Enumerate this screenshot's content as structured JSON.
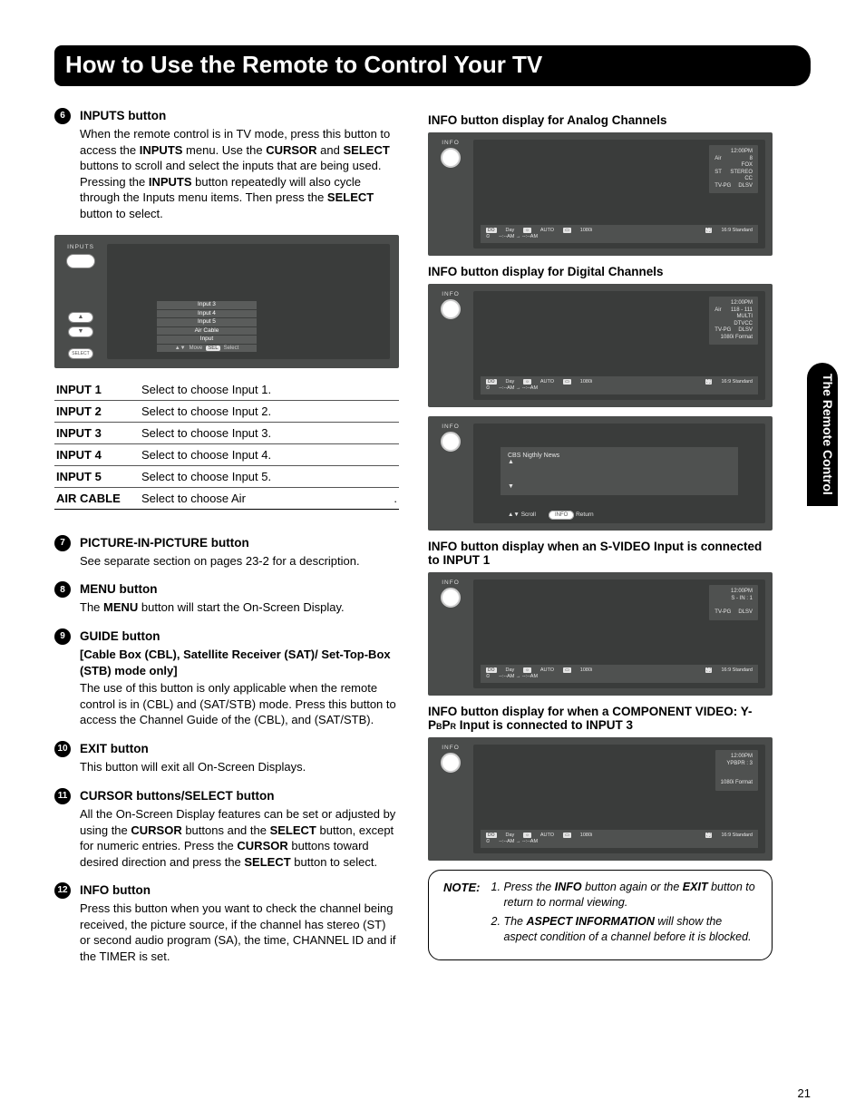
{
  "page": {
    "title": "How to Use the Remote to Control Your TV",
    "side_tab": "The Remote Control",
    "page_number": "21"
  },
  "left_entries": [
    {
      "num": "6",
      "title": "INPUTS button",
      "html": "When the remote control is in TV mode, press this button to access the <b>INPUTS</b> menu. Use the <b>CURSOR</b> and <b>SELECT</b> buttons to scroll and select the inputs that are being used. Pressing the <b>INPUTS</b> button repeatedly will also cycle through the Inputs menu items. Then press the <b>SELECT</b> button to select."
    },
    {
      "num": "7",
      "title": "PICTURE-IN-PICTURE button",
      "html": "See separate section on pages 23-2  for a description."
    },
    {
      "num": "8",
      "title": "MENU button",
      "html": "The <b>MENU</b> button will start the On-Screen Display."
    },
    {
      "num": "9",
      "title": "GUIDE button",
      "sub_html": "[Cable Box (CBL), Satellite Receiver (SAT)/ Set-Top-Box (STB) mode only]",
      "html": "The use of this button is only applicable when the remote control is in (CBL) and (SAT/STB) mode. Press this button to access the Channel Guide of the (CBL), and (SAT/STB)."
    },
    {
      "num": "10",
      "title": "EXIT button",
      "html": "This button will exit all On-Screen Displays."
    },
    {
      "num": "11",
      "title": "CURSOR buttons/SELECT button",
      "html": "All the On-Screen Display features can be set or adjusted by using the <b>CURSOR</b> buttons and the <b>SELECT</b> button, except for numeric entries. Press the <b>CURSOR</b> buttons toward desired direction and press the <b>SELECT</b> button to select."
    },
    {
      "num": "12",
      "title": "INFO button",
      "html": "Press this button when you want to check the channel being received, the picture source, if the channel has stereo (ST) or second audio program (SA), the time, CHANNEL ID and if the TIMER is set."
    }
  ],
  "inputs_shot": {
    "label": "INPUTS",
    "select_label": "SELECT",
    "menu_items": [
      "Input 3",
      "Input 4",
      "Input 5",
      "Air   Cable",
      "Input "
    ],
    "hint_move": "Move",
    "hint_sel": "SEL",
    "hint_select": "Select"
  },
  "input_table": [
    {
      "k": "INPUT 1",
      "v": "Select to choose Input 1."
    },
    {
      "k": "INPUT 2",
      "v": "Select to choose Input 2."
    },
    {
      "k": "INPUT 3",
      "v": "Select to choose Input 3."
    },
    {
      "k": "INPUT 4",
      "v": "Select to choose Input 4."
    },
    {
      "k": "INPUT 5",
      "v": "Select to choose Input 5."
    },
    {
      "k": "AIR CABLE",
      "v": "Select to choose Air",
      "dot": "."
    }
  ],
  "right": {
    "h1": "INFO button display for Analog Channels",
    "h2": "INFO button display for Digital Channels",
    "h3": "INFO button display when an S-VIDEO Input is connected to INPUT 1",
    "h4_html": "INFO button display for when a COMPONENT VIDEO: Y-P<span style='font-size:9px'>B</span>P<span style='font-size:9px'>R</span> Input is connected to INPUT 3",
    "info_label": "INFO"
  },
  "analog_box": {
    "time": "12:00PM",
    "r1a": "Air",
    "r1b": "8",
    "l2": "FOX",
    "r2a": "ST",
    "r2b": "STEREO",
    "l3": "CC",
    "r3a": "TV-PG",
    "r3b": "DLSV"
  },
  "digital_box": {
    "time": "12:00PM",
    "r1a": "Air",
    "r1b": "118 - 111",
    "l2": "MULTI",
    "l3": "DTVCC",
    "r3a": "TV-PG",
    "r3b": "DLSV",
    "l4": "1080i Format"
  },
  "digital_scroll": {
    "item": "CBS Nigthly News",
    "scroll": "Scroll",
    "return_btn": "INFO",
    "return": "Return"
  },
  "svideo_box": {
    "time": "12:00PM",
    "l1": "S - IN : 1",
    "r3a": "TV-PG",
    "r3b": "DLSV"
  },
  "component_box": {
    "time": "12:00PM",
    "l1": "YPBPR : 3",
    "l4": "1080i  Format"
  },
  "status": {
    "day_tag": "DO",
    "day": "Day",
    "auto_tag": "☼",
    "auto": "AUTO",
    "res_tag": "▭",
    "res": "1080i",
    "asp_tag": "⛶",
    "asp": "16:9 Standard",
    "timer": "--:--AM → --:--AM",
    "clock_icon": "⏲"
  },
  "note": {
    "label": "NOTE:",
    "items": [
      "Press the <b>INFO</b> button again or the <b>EXIT</b> button to return to normal viewing.",
      "The <b>ASPECT INFORMATION</b> will show the aspect condition of a channel before it is blocked."
    ]
  }
}
